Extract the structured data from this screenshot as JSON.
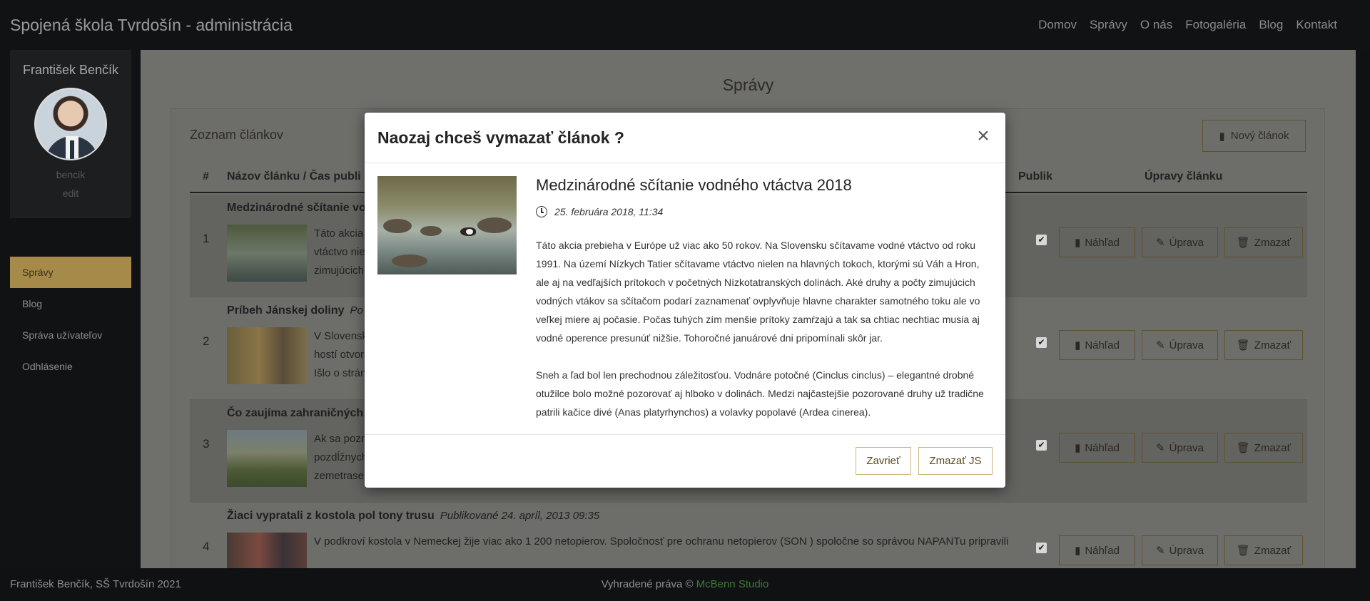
{
  "navbar": {
    "brand": "Spojená škola Tvrdošín - administrácia",
    "links": [
      "Domov",
      "Správy",
      "O nás",
      "Fotogaléria",
      "Blog",
      "Kontakt"
    ]
  },
  "sidebar": {
    "name": "František Benčík",
    "username": "bencik",
    "edit": "edit",
    "menu": [
      "Správy",
      "Blog",
      "Správa užívateľov",
      "Odhlásenie"
    ]
  },
  "main": {
    "heading": "Správy",
    "panel_title": "Zoznam článkov",
    "new_button": "Nový článok",
    "columns": {
      "num": "#",
      "title": "Názov článku / Čas publi",
      "published": "Publik",
      "actions": "Úpravy článku"
    },
    "rows": [
      {
        "num": "1",
        "title": "Medzinárodné sčítanie vo",
        "meta": "",
        "excerpt": "Táto akcia",
        "excerpt2": "vtáctvo nie",
        "excerpt3": "zimujúcich"
      },
      {
        "num": "2",
        "title": "Príbeh Jánskej doliny",
        "meta": "Po",
        "excerpt": "V Slovensk",
        "excerpt2": "hostí otvor",
        "excerpt3": "Išlo o strán"
      },
      {
        "num": "3",
        "title": "Čo zaujíma zahraničných",
        "meta": "",
        "excerpt": "Ak sa pozr",
        "excerpt2": "pozdĺžnych",
        "excerpt3": "zemetrasen"
      },
      {
        "num": "4",
        "title": "Žiaci vypratali z kostola pol tony trusu",
        "meta": "Publikované  24. apríl, 2013 09:35",
        "excerpt": "V podkroví kostola v Nemeckej žije viac ako 1 200 netopierov. Spoločnosť pre ochranu netopierov (SON ) spoločne so správou NAPANTu pripravili",
        "excerpt2": "",
        "excerpt3": ""
      }
    ],
    "actions": {
      "preview": "Náhľad",
      "edit": "Úprava",
      "delete": "Zmazať"
    }
  },
  "footer": {
    "left": "František Benčík, SŠ Tvrdošín 2021",
    "rights": "Vyhradené práva ©",
    "studio": "McBenn Studio"
  },
  "modal": {
    "title": "Naozaj chceš vymazať článok ?",
    "close": "×",
    "article_title": "Medzinárodné sčítanie vodného vtáctva 2018",
    "article_date": "25. februára 2018, 11:34",
    "paragraph1": "Táto akcia prebieha v Európe už viac ako 50 rokov. Na Slovensku sčítavame vodné vtáctvo od roku 1991. Na území Nízkych Tatier sčítavame vtáctvo nielen na hlavných tokoch, ktorými sú Váh a Hron, ale aj na vedľajších prítokoch v početných Nízkotatranských dolinách. Aké druhy a počty zimujúcich vodných vtákov sa sčítačom podarí zaznamenať ovplyvňuje hlavne charakter samotného toku ale vo veľkej miere aj počasie. Počas tuhých zím menšie prítoky zamŕzajú a tak sa chtiac nechtiac musia aj vodné operence presunúť nižšie. Tohoročné januárové dni pripomínali skôr jar.",
    "paragraph2": "Sneh a ľad bol len prechodnou záležitosťou. Vodnáre potočné (Cinclus cinclus) – elegantné drobné otužilce bolo možné pozorovať aj hlboko v dolinách. Medzi najčastejšie pozorované druhy už tradične patrili kačice divé (Anas platyrhynchos) a volavky popolavé (Ardea cinerea).",
    "cancel_button": "Zavrieť",
    "delete_button": "Zmazať JS"
  }
}
